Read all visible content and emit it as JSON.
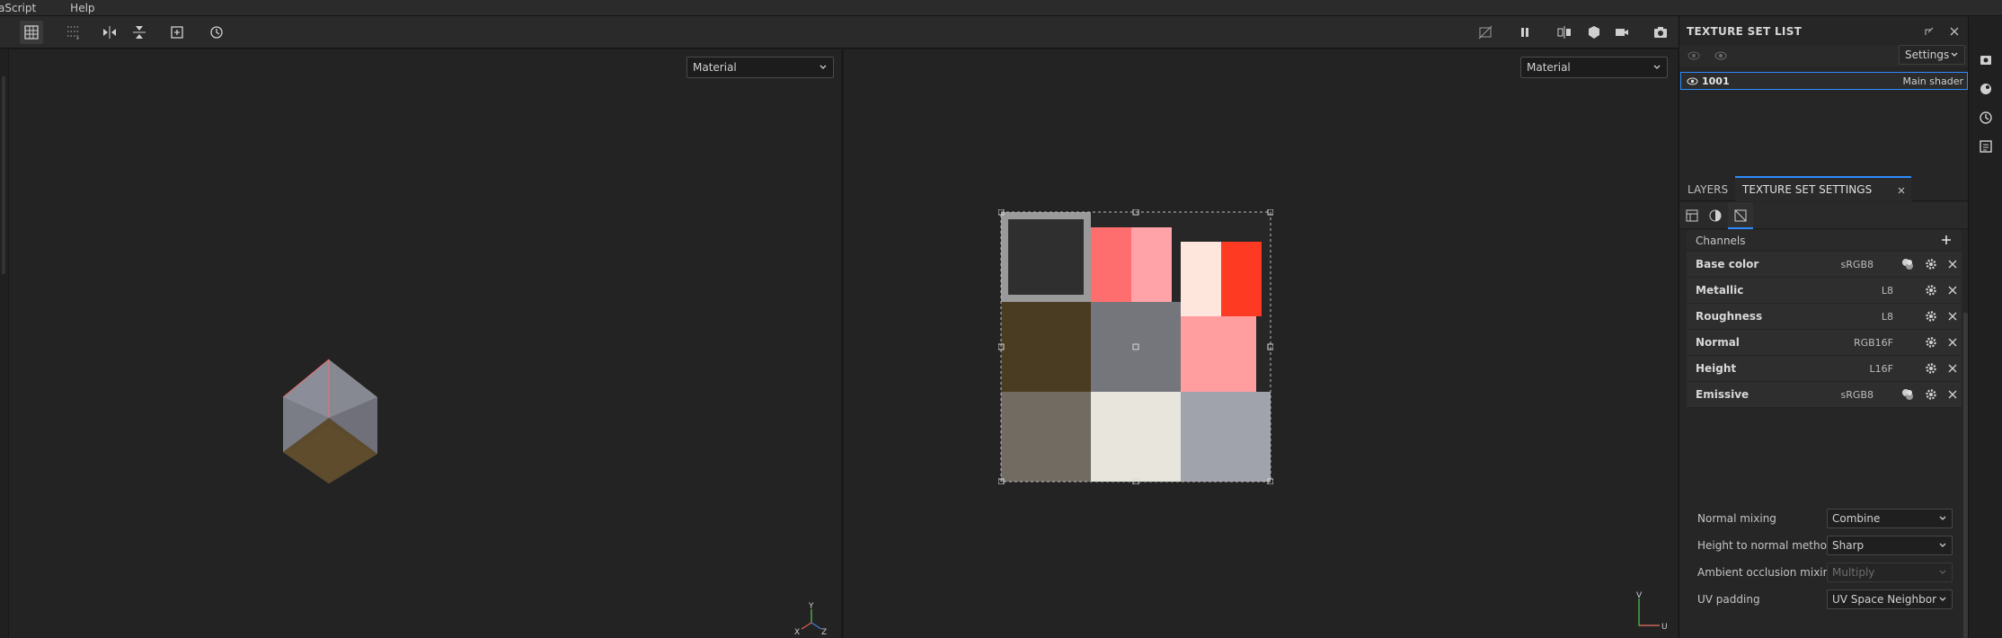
{
  "menu": {
    "items": [
      "aScript",
      "Help"
    ]
  },
  "viewports": {
    "left": {
      "mode": "Material"
    },
    "right": {
      "mode": "Material"
    }
  },
  "texture_set_list": {
    "title": "TEXTURE SET LIST",
    "settings_label": "Settings",
    "items": [
      {
        "name": "1001",
        "shader": "Main shader"
      }
    ]
  },
  "tabs": [
    {
      "label": "LAYERS",
      "active": false
    },
    {
      "label": "TEXTURE SET SETTINGS",
      "active": true
    }
  ],
  "channels": {
    "header": "Channels",
    "items": [
      {
        "name": "Base color",
        "format": "sRGB8"
      },
      {
        "name": "Metallic",
        "format": "L8"
      },
      {
        "name": "Roughness",
        "format": "L8"
      },
      {
        "name": "Normal",
        "format": "RGB16F"
      },
      {
        "name": "Height",
        "format": "L16F"
      },
      {
        "name": "Emissive",
        "format": "sRGB8"
      }
    ]
  },
  "properties": [
    {
      "label": "Normal mixing",
      "value": "Combine",
      "enabled": true
    },
    {
      "label": "Height to normal method",
      "value": "Sharp",
      "enabled": true
    },
    {
      "label": "Ambient occlusion mixing",
      "value": "Multiply",
      "enabled": false
    },
    {
      "label": "UV padding",
      "value": "UV Space Neighbor",
      "enabled": true
    }
  ],
  "gizmo": {
    "x": "X",
    "y": "Y",
    "z": "Z"
  },
  "uv_axis": {
    "u": "U",
    "v": "V"
  },
  "colors": {
    "accent": "#2e8bff",
    "selection_outline": "#ff6b6b",
    "uv_swatches": [
      "#2f2f2f",
      "#ff6e6e",
      "#ffa3a8",
      "#ffe6dc",
      "#ff3a22",
      "#4a3b23",
      "#75767b",
      "#ff9d9f",
      "#716b62",
      "#e8e6dc",
      "#a0a3ab"
    ]
  }
}
